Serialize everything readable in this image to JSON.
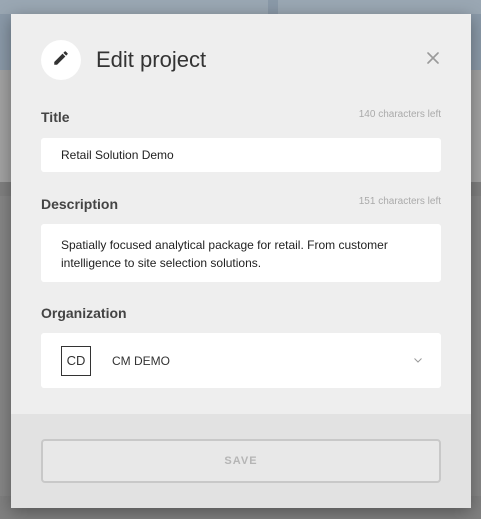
{
  "modal": {
    "title": "Edit project",
    "header_icon": "pencil-icon",
    "close_icon": "close-icon"
  },
  "title_field": {
    "label": "Title",
    "counter": "140 characters left",
    "value": "Retail Solution Demo"
  },
  "description_field": {
    "label": "Description",
    "counter": "151 characters left",
    "value": "Spatially focused analytical package for retail. From customer intelligence to site selection solutions."
  },
  "organization_field": {
    "label": "Organization",
    "avatar_initials": "CD",
    "selected": "CM DEMO",
    "chevron_icon": "chevron-down-icon"
  },
  "footer": {
    "save_label": "SAVE"
  },
  "colors": {
    "modal_bg": "#eeeeee",
    "footer_bg": "#e2e2e2",
    "disabled_text": "#b5b5b5"
  }
}
